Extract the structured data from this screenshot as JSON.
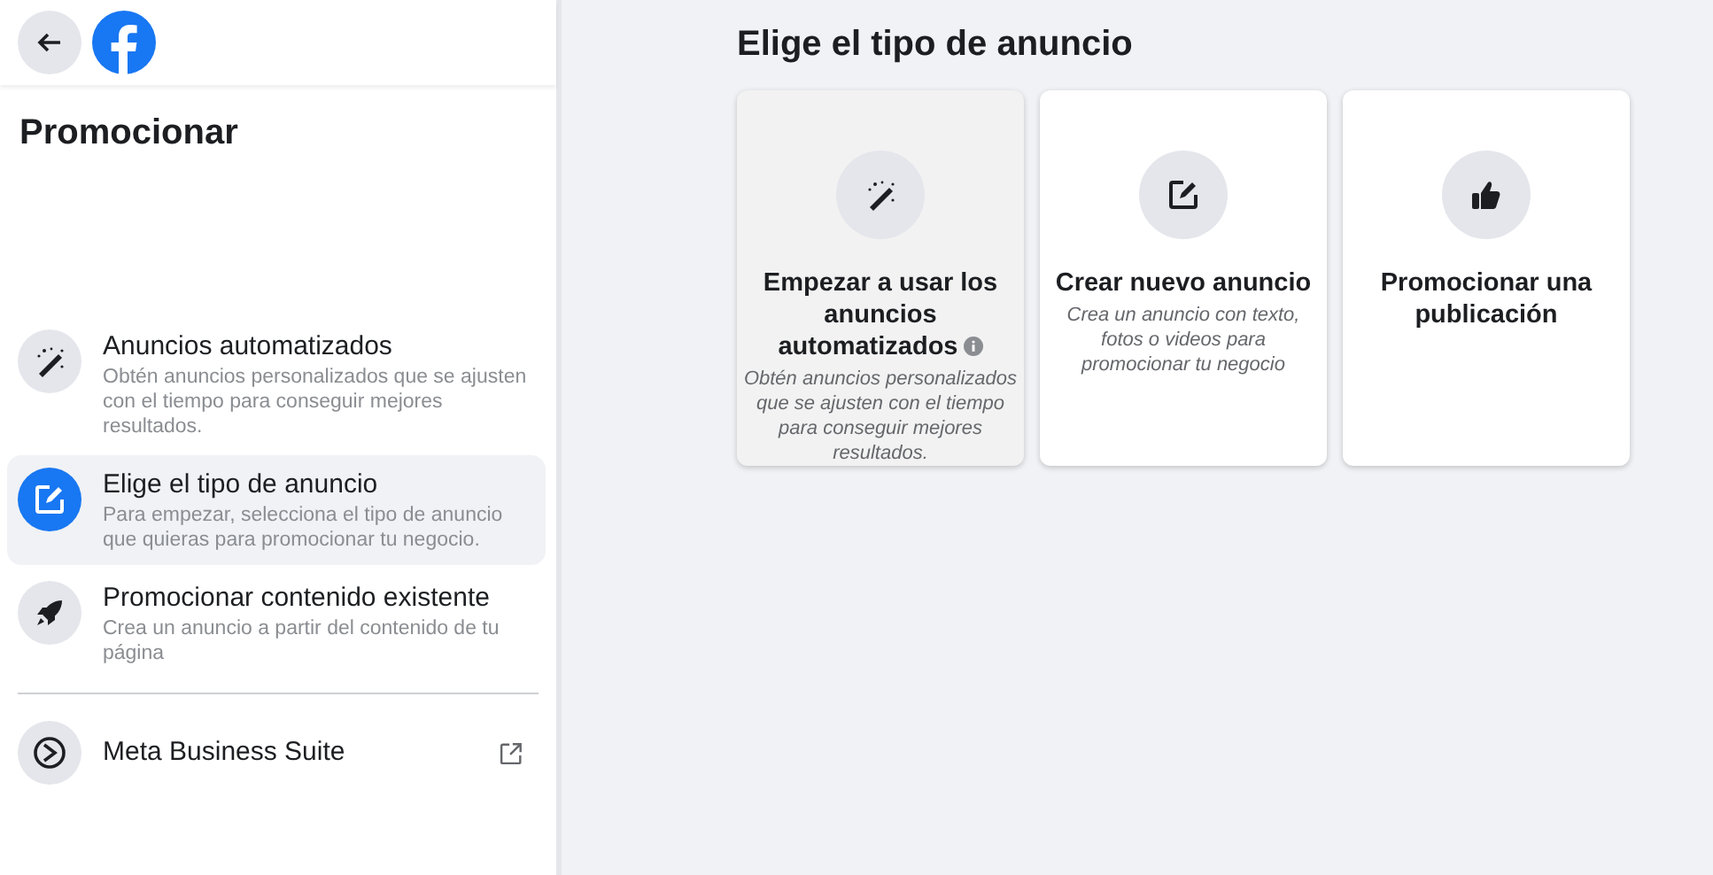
{
  "sidebar": {
    "title": "Promocionar",
    "items": [
      {
        "kind": "wand",
        "label": "Anuncios automatizados",
        "description": "Obtén anuncios personalizados que se ajusten con el tiempo para conseguir mejores resultados.",
        "selected": false
      },
      {
        "kind": "edit",
        "label": "Elige el tipo de anuncio",
        "description": "Para empezar, selecciona el tipo de anuncio que quieras para promocionar tu negocio.",
        "selected": true
      },
      {
        "kind": "rocket",
        "label": "Promocionar contenido existente",
        "description": "Crea un anuncio a partir del contenido de tu página",
        "selected": false
      }
    ],
    "footer_item": {
      "label": "Meta Business Suite"
    }
  },
  "main": {
    "title": "Elige el tipo de anuncio",
    "cards": [
      {
        "kind": "wand",
        "title": "Empezar a usar los anuncios automatizados",
        "info": true,
        "description": "Obtén anuncios personalizados que se ajusten con el tiempo para conseguir mejores resultados.",
        "highlighted": true
      },
      {
        "kind": "edit",
        "title": "Crear nuevo anuncio",
        "info": false,
        "description": "Crea un anuncio con texto, fotos o videos para promocionar tu negocio",
        "highlighted": false
      },
      {
        "kind": "thumb",
        "title": "Promocionar una publicación",
        "info": false,
        "highlighted": false
      }
    ]
  }
}
